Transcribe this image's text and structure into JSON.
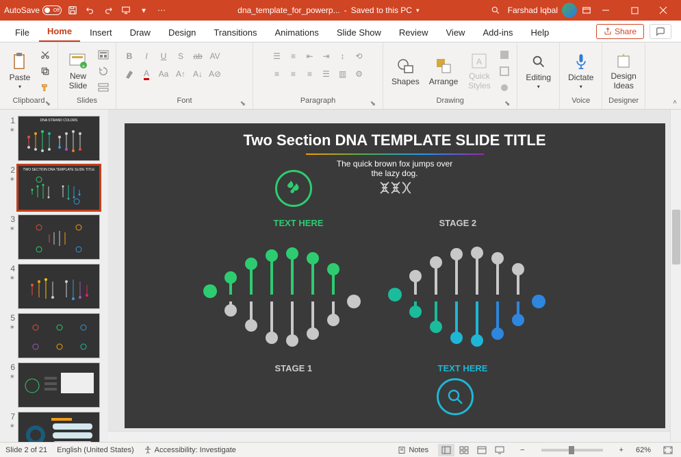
{
  "titlebar": {
    "autosave_label": "AutoSave",
    "autosave_state": "Off",
    "doc_name": "dna_template_for_powerp...",
    "save_status": "Saved to this PC",
    "user_name": "Farshad Iqbal"
  },
  "tabs": {
    "items": [
      "File",
      "Home",
      "Insert",
      "Draw",
      "Design",
      "Transitions",
      "Animations",
      "Slide Show",
      "Review",
      "View",
      "Add-ins",
      "Help"
    ],
    "active": "Home",
    "share_label": "Share"
  },
  "ribbon": {
    "clipboard": {
      "label": "Clipboard",
      "paste": "Paste"
    },
    "slides": {
      "label": "Slides",
      "new_slide": "New\nSlide"
    },
    "font": {
      "label": "Font"
    },
    "paragraph": {
      "label": "Paragraph"
    },
    "drawing": {
      "label": "Drawing",
      "shapes": "Shapes",
      "arrange": "Arrange",
      "quick_styles": "Quick\nStyles"
    },
    "editing": {
      "label": "Editing",
      "btn": "Editing"
    },
    "voice": {
      "label": "Voice",
      "dictate": "Dictate"
    },
    "designer": {
      "label": "Designer",
      "btn": "Design\nIdeas"
    }
  },
  "thumbnails": {
    "count": 7,
    "selected": 2,
    "titles": [
      "DNA STRAND COLORS",
      "TWO SECTION DNA TEMPLATE SLIDE TITLE",
      "",
      "",
      "",
      "",
      ""
    ]
  },
  "slide": {
    "title": "Two Section DNA TEMPLATE SLIDE TITLE",
    "subtitle": "The quick brown fox jumps over\nthe lazy dog.",
    "text_here_1": "TEXT HERE",
    "stage_1": "STAGE 1",
    "stage_2": "STAGE 2",
    "text_here_2": "TEXT HERE"
  },
  "statusbar": {
    "slide_pos": "Slide 2 of 21",
    "language": "English (United States)",
    "accessibility": "Accessibility: Investigate",
    "notes": "Notes",
    "zoom": "62%"
  }
}
